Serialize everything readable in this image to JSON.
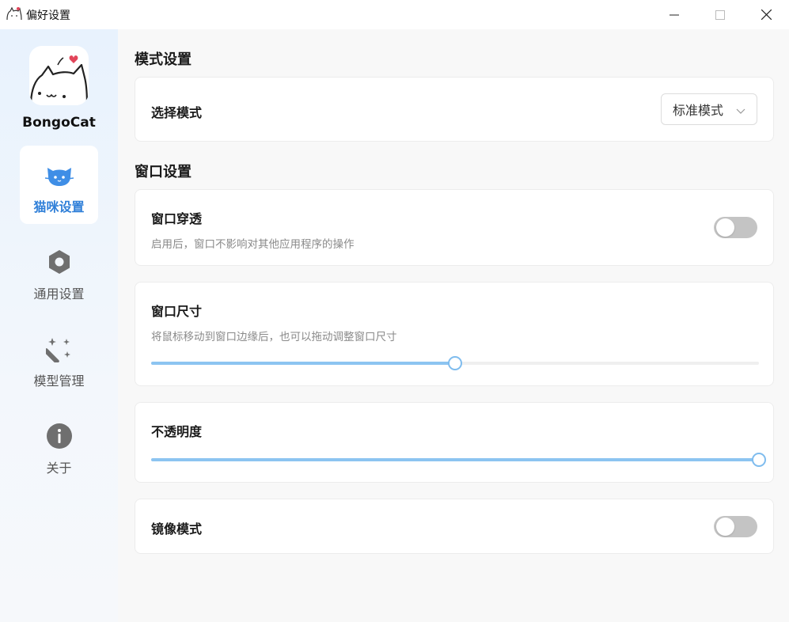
{
  "window": {
    "title": "偏好设置"
  },
  "sidebar": {
    "brand": "BongoCat",
    "items": [
      {
        "label": "猫咪设置",
        "icon": "cat-icon",
        "active": true
      },
      {
        "label": "通用设置",
        "icon": "settings-hexagon-icon",
        "active": false
      },
      {
        "label": "模型管理",
        "icon": "magic-wand-icon",
        "active": false
      },
      {
        "label": "关于",
        "icon": "info-icon",
        "active": false
      }
    ]
  },
  "main": {
    "mode_section": {
      "title": "模式设置",
      "select_label": "选择模式",
      "select_value": "标准模式"
    },
    "window_section": {
      "title": "窗口设置",
      "passthrough": {
        "label": "窗口穿透",
        "desc": "启用后，窗口不影响对其他应用程序的操作",
        "enabled": false
      },
      "size": {
        "label": "窗口尺寸",
        "desc": "将鼠标移动到窗口边缘后，也可以拖动调整窗口尺寸",
        "value_percent": 50
      },
      "opacity": {
        "label": "不透明度",
        "value_percent": 100
      },
      "mirror": {
        "label": "镜像模式",
        "enabled": false
      }
    }
  },
  "colors": {
    "accent": "#2f7fd8",
    "slider_fill": "#8cc4f1",
    "toggle_off": "#c4c4c4"
  }
}
